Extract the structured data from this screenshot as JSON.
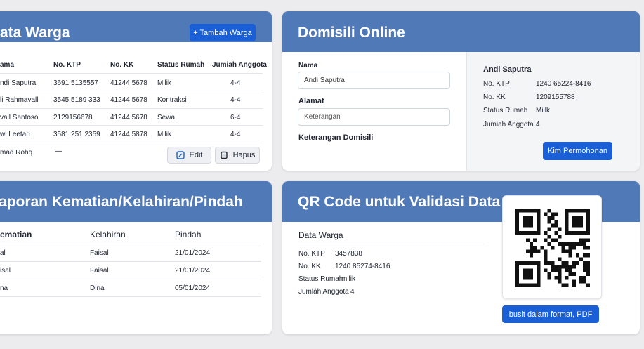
{
  "data_warga": {
    "title": "ata Warga",
    "add_button": "+ Tambah Warga",
    "headers": [
      "ama",
      "No. KTP",
      "No. KK",
      "Status Rumah",
      "Jumiah Anggota"
    ],
    "rows": [
      [
        "ndi Saputra",
        "3691 5135557",
        "41244 5678",
        "Milik",
        "4-4"
      ],
      [
        "li Rahmavall",
        "3545 5189 333",
        "41244 5678",
        "Koritraksi",
        "4-4"
      ],
      [
        "vall Santoso",
        "2129156678",
        "41244 5678",
        "Sewa",
        "6-4"
      ],
      [
        "wi Leetari",
        "3581 251 2359",
        "41244 5878",
        "Milik",
        "4-4"
      ],
      [
        "mad Rohq",
        "—",
        "",
        "",
        ""
      ]
    ],
    "edit_label": "Edit",
    "hapus_label": "Hapus"
  },
  "domisili": {
    "title": "Domisili Online",
    "nama_label": "Nama",
    "nama_value": "Andi Saputra",
    "alamat_label": "Alamat",
    "alamat_placeholder": "Keterangan",
    "keterangan_label": "Keterangan Domisili",
    "info": {
      "name": "Andi Saputra",
      "rows": [
        {
          "k": "No. KTP",
          "v": "1240 65224-8416"
        },
        {
          "k": "No. KK",
          "v": "1209155788"
        },
        {
          "k": "Status Rumah",
          "v": "Miilk"
        },
        {
          "k": "Jumiah Anggota",
          "v": "4"
        }
      ]
    },
    "submit_label": "Kim Permohonan"
  },
  "laporan": {
    "title": "aporan Kematian/Kelahiran/Pindah",
    "headers": [
      "ematian",
      "Kelahiran",
      "Pindah"
    ],
    "rows": [
      [
        "al",
        "Faisal",
        "21/01/2024"
      ],
      [
        "isal",
        "Faisal",
        "21/01/2024"
      ],
      [
        "na",
        "Dina",
        "05/01/2024"
      ]
    ]
  },
  "qr": {
    "title": "QR Code untuk Validasi Data",
    "section_label": "Data Warga",
    "rows": [
      {
        "k": "No. KTP",
        "v": "3457838"
      },
      {
        "k": "No. KK",
        "v": "1240 85274-8416"
      },
      {
        "k": "Status Rumah",
        "v": "milik"
      },
      {
        "k": "Jumlâh Anggota",
        "v": "4"
      }
    ],
    "pdf_button": "busit dalam format, PDF"
  },
  "colors": {
    "header": "#5079b7",
    "primary": "#1a5fd6",
    "background": "#ececee"
  }
}
